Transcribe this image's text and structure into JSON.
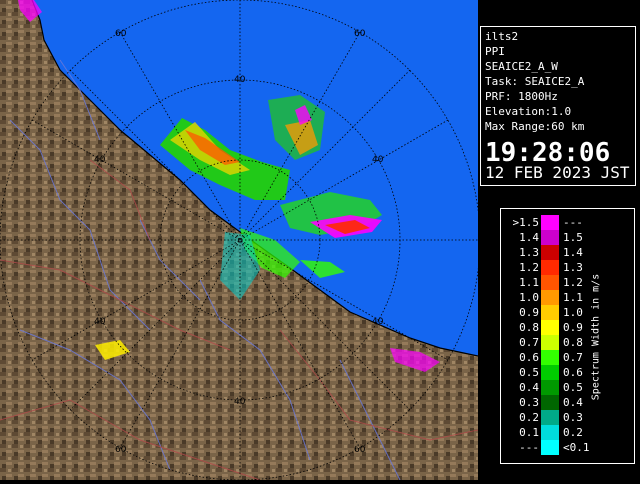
{
  "header": {
    "station": "ilts2",
    "product": "PPI",
    "scan_name": "SEAICE2_A_W",
    "task": "Task: SEAICE2_A",
    "prf": "PRF: 1800Hz",
    "elevation": "Elevation:1.0",
    "max_range": "Max Range:60 km",
    "time": "19:28:06",
    "date": "12 FEB 2023 JST"
  },
  "map": {
    "range_ring_labels": [
      "60",
      "60",
      "40",
      "40",
      "40",
      "40",
      "40",
      "60",
      "60",
      "40"
    ],
    "colors": {
      "sea": "#1466f0",
      "land": "#7a6448",
      "rings": "#000000"
    }
  },
  "legend": {
    "title": "Spectrum Width in m/s",
    "rows": [
      {
        "left": ">1.5",
        "right": "---",
        "color": "#ff00ff"
      },
      {
        "left": "1.4",
        "right": "1.5",
        "color": "#cc00cc"
      },
      {
        "left": "1.3",
        "right": "1.4",
        "color": "#cc0000"
      },
      {
        "left": "1.2",
        "right": "1.3",
        "color": "#ff2a00"
      },
      {
        "left": "1.1",
        "right": "1.2",
        "color": "#ff5500"
      },
      {
        "left": "1.0",
        "right": "1.1",
        "color": "#ff9900"
      },
      {
        "left": "0.9",
        "right": "1.0",
        "color": "#ffcc00"
      },
      {
        "left": "0.8",
        "right": "0.9",
        "color": "#ffff00"
      },
      {
        "left": "0.7",
        "right": "0.8",
        "color": "#ccff00"
      },
      {
        "left": "0.6",
        "right": "0.7",
        "color": "#33ff00"
      },
      {
        "left": "0.5",
        "right": "0.6",
        "color": "#00cc00"
      },
      {
        "left": "0.4",
        "right": "0.5",
        "color": "#009900"
      },
      {
        "left": "0.3",
        "right": "0.4",
        "color": "#006600"
      },
      {
        "left": "0.2",
        "right": "0.3",
        "color": "#00aa88"
      },
      {
        "left": "0.1",
        "right": "0.2",
        "color": "#00dddd"
      },
      {
        "left": "---",
        "right": "<0.1",
        "color": "#00ffff"
      }
    ]
  }
}
